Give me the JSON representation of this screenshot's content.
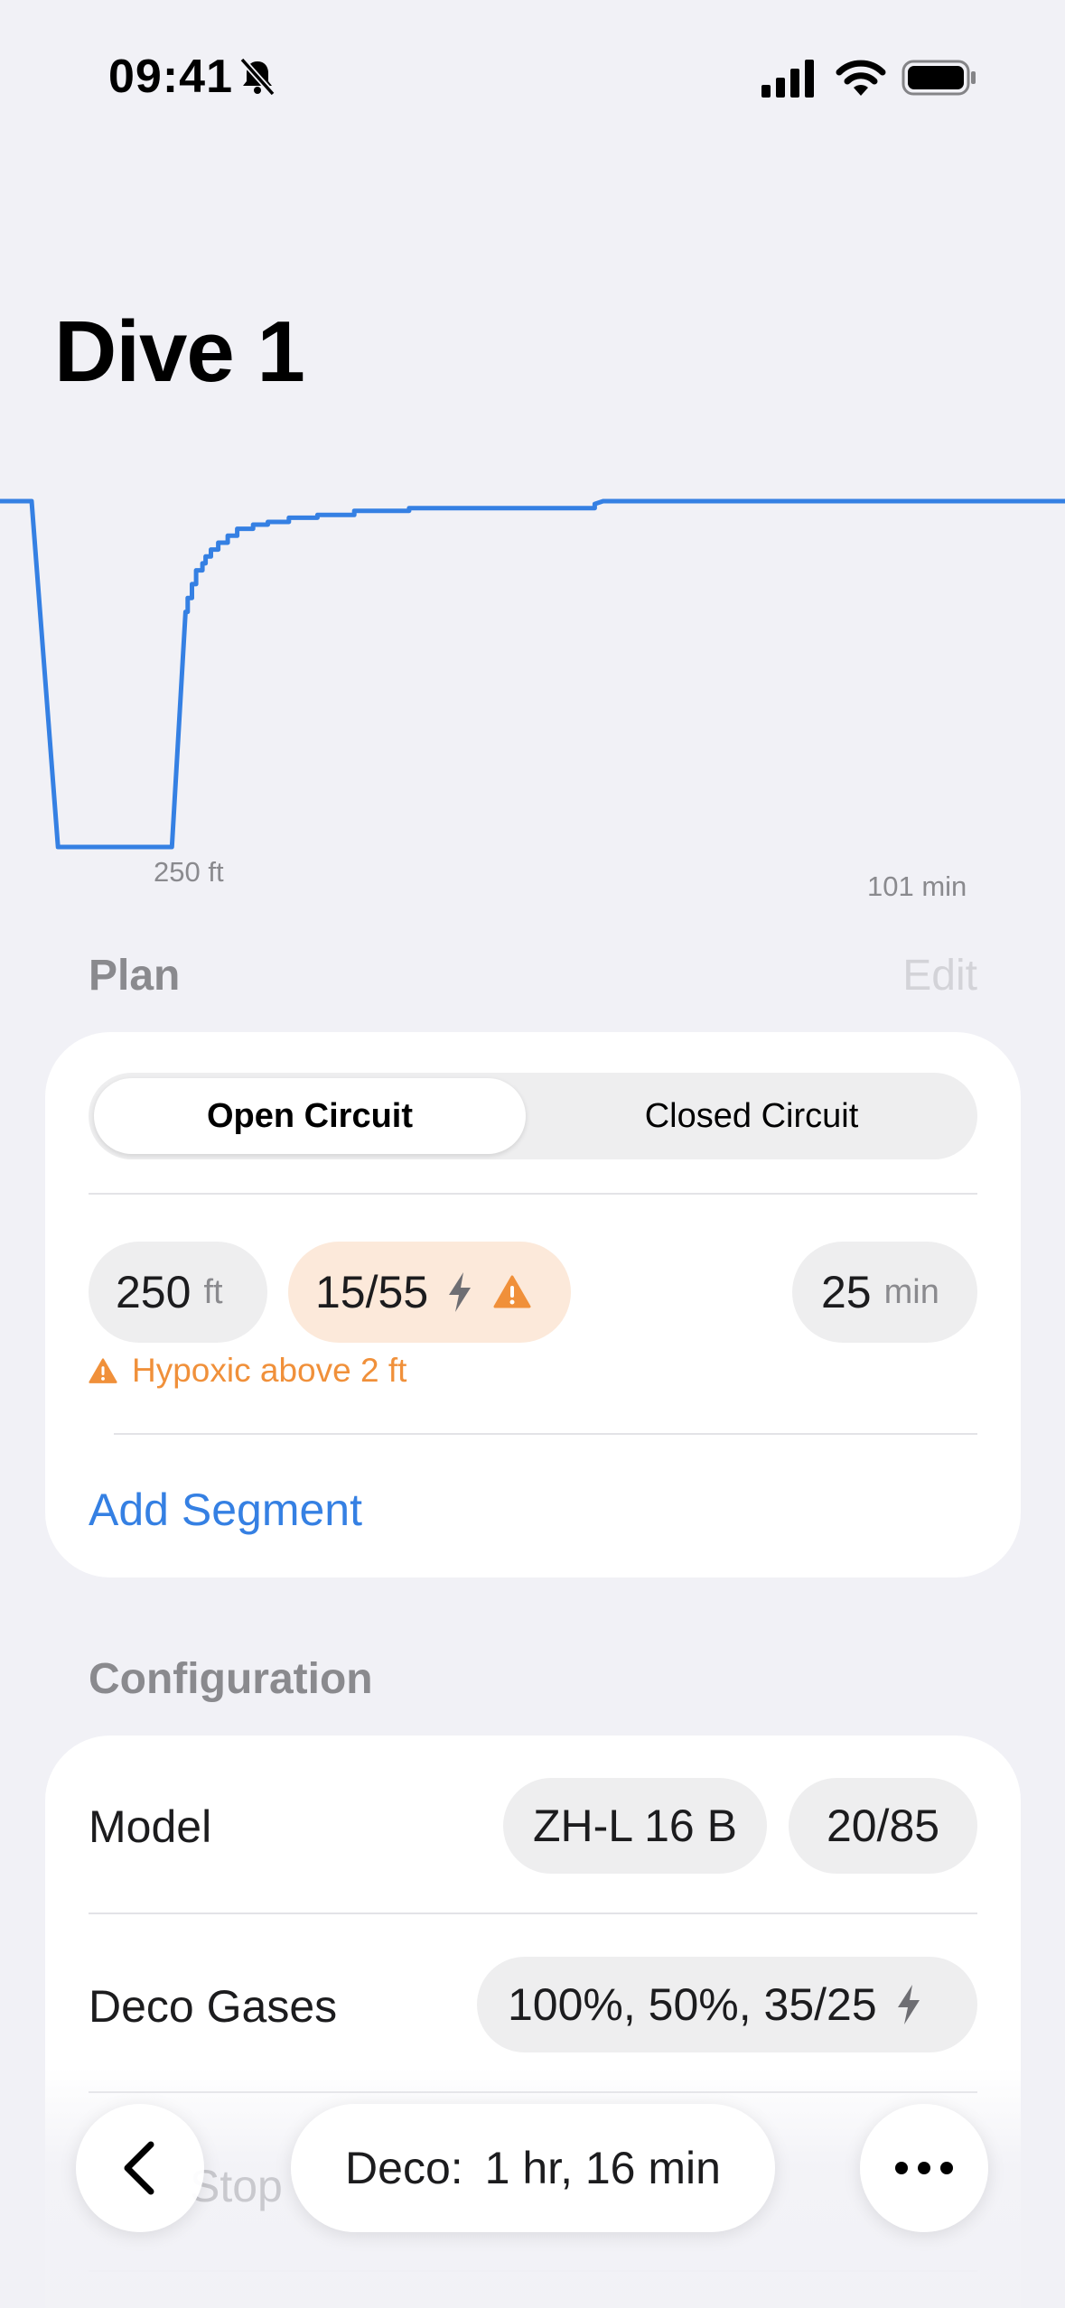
{
  "status_bar": {
    "time": "09:41"
  },
  "title": "Dive 1",
  "chart_data": {
    "type": "line",
    "xlabel": "",
    "ylabel": "",
    "max_depth_label": "250 ft",
    "total_time_label": "101 min",
    "y_inverted": true,
    "ylim": [
      0,
      260
    ],
    "xlim": [
      0,
      101
    ],
    "series": [
      {
        "x": [
          0,
          3,
          5.5,
          16.3,
          17.6,
          17.8,
          18.2,
          18.6,
          19.2,
          19.5,
          20.0,
          20.7,
          21.6,
          22.5,
          24.0,
          25.4,
          27.4,
          30.1,
          33.6,
          38.8,
          56.4,
          57.2,
          61
        ],
        "y": [
          0,
          0,
          250,
          250,
          80,
          70,
          60,
          50,
          45,
          40,
          35,
          30,
          25,
          20,
          17,
          15,
          12,
          10,
          7,
          5,
          2,
          0,
          0
        ]
      }
    ]
  },
  "plan": {
    "header": "Plan",
    "edit_label": "Edit",
    "segmented": {
      "active": "Open Circuit",
      "inactive": "Closed Circuit"
    },
    "segment": {
      "depth_value": "250",
      "depth_unit": "ft",
      "gas": "15/55",
      "time_value": "25",
      "time_unit": "min",
      "warning": "Hypoxic above 2 ft"
    },
    "add_segment": "Add Segment"
  },
  "configuration": {
    "header": "Configuration",
    "model_label": "Model",
    "model_value": "ZH-L 16 B",
    "gradient_value": "20/85",
    "deco_gases_label": "Deco Gases",
    "deco_gases_value": "100%, 50%, 35/25",
    "partial_row_label": "Stop"
  },
  "bottom_bar": {
    "deco_label": "Deco:",
    "deco_value": "1 hr, 16 min"
  },
  "colors": {
    "accent": "#3580E3",
    "warning": "#F0903A",
    "warning_bg": "#FCE9DA",
    "background": "#F1F1F6"
  }
}
